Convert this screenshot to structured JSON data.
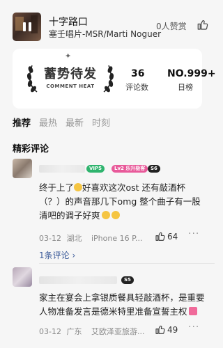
{
  "song": {
    "title": "十字路口",
    "artist": "塞壬唱片-MSR/Marti Noguer",
    "likes_text": "0人赞赏"
  },
  "stats": {
    "badge_text": "蓄势待发",
    "badge_sub": "COMMENT HEAT",
    "comment_count": "36",
    "comment_label": "评论数",
    "rank": "NO.999+",
    "rank_label": "日榜"
  },
  "tabs": [
    {
      "label": "推荐",
      "active": true
    },
    {
      "label": "最热",
      "active": false
    },
    {
      "label": "最新",
      "active": false
    },
    {
      "label": "时刻",
      "active": false
    }
  ],
  "section_title": "精彩评论",
  "comments": [
    {
      "tags": [
        "VIP5",
        "Lv2 乐升极客",
        "S6"
      ],
      "text_before_emoji": "终于上了",
      "text_after_emoji": "好喜欢这次ost 还有敲酒杯（？）的声音那几下omg 整个曲子有一股清吧的调子好爽",
      "date": "03-12",
      "location": "湖北",
      "device": "iPhone 16 P...",
      "like_count": "64",
      "replies_text": "1条评论"
    },
    {
      "tags": [
        "S5"
      ],
      "text": "家主在宴会上拿银质餐具轻敲酒杯，是重要人物准备发言是德米特里准备宣誓主权",
      "date": "03-12",
      "location": "广东",
      "device": "艾欧泽亚旅游...",
      "like_count": "49"
    }
  ],
  "colors": {
    "vip": "#2fb46e",
    "level": "#e85a9a",
    "badge": "#222222",
    "link": "#3a5a99"
  }
}
